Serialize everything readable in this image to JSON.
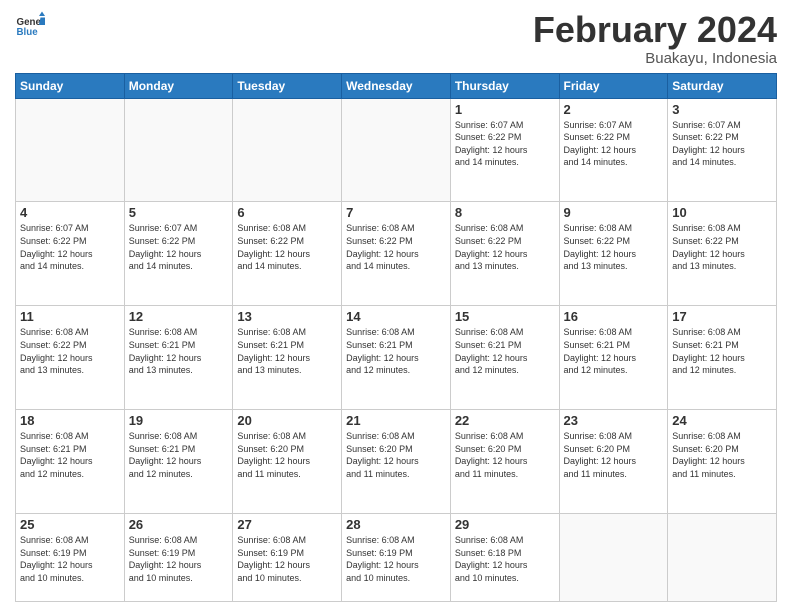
{
  "header": {
    "logo_general": "General",
    "logo_blue": "Blue",
    "month_title": "February 2024",
    "subtitle": "Buakayu, Indonesia"
  },
  "weekdays": [
    "Sunday",
    "Monday",
    "Tuesday",
    "Wednesday",
    "Thursday",
    "Friday",
    "Saturday"
  ],
  "weeks": [
    [
      {
        "day": "",
        "info": ""
      },
      {
        "day": "",
        "info": ""
      },
      {
        "day": "",
        "info": ""
      },
      {
        "day": "",
        "info": ""
      },
      {
        "day": "1",
        "info": "Sunrise: 6:07 AM\nSunset: 6:22 PM\nDaylight: 12 hours\nand 14 minutes."
      },
      {
        "day": "2",
        "info": "Sunrise: 6:07 AM\nSunset: 6:22 PM\nDaylight: 12 hours\nand 14 minutes."
      },
      {
        "day": "3",
        "info": "Sunrise: 6:07 AM\nSunset: 6:22 PM\nDaylight: 12 hours\nand 14 minutes."
      }
    ],
    [
      {
        "day": "4",
        "info": "Sunrise: 6:07 AM\nSunset: 6:22 PM\nDaylight: 12 hours\nand 14 minutes."
      },
      {
        "day": "5",
        "info": "Sunrise: 6:07 AM\nSunset: 6:22 PM\nDaylight: 12 hours\nand 14 minutes."
      },
      {
        "day": "6",
        "info": "Sunrise: 6:08 AM\nSunset: 6:22 PM\nDaylight: 12 hours\nand 14 minutes."
      },
      {
        "day": "7",
        "info": "Sunrise: 6:08 AM\nSunset: 6:22 PM\nDaylight: 12 hours\nand 14 minutes."
      },
      {
        "day": "8",
        "info": "Sunrise: 6:08 AM\nSunset: 6:22 PM\nDaylight: 12 hours\nand 13 minutes."
      },
      {
        "day": "9",
        "info": "Sunrise: 6:08 AM\nSunset: 6:22 PM\nDaylight: 12 hours\nand 13 minutes."
      },
      {
        "day": "10",
        "info": "Sunrise: 6:08 AM\nSunset: 6:22 PM\nDaylight: 12 hours\nand 13 minutes."
      }
    ],
    [
      {
        "day": "11",
        "info": "Sunrise: 6:08 AM\nSunset: 6:22 PM\nDaylight: 12 hours\nand 13 minutes."
      },
      {
        "day": "12",
        "info": "Sunrise: 6:08 AM\nSunset: 6:21 PM\nDaylight: 12 hours\nand 13 minutes."
      },
      {
        "day": "13",
        "info": "Sunrise: 6:08 AM\nSunset: 6:21 PM\nDaylight: 12 hours\nand 13 minutes."
      },
      {
        "day": "14",
        "info": "Sunrise: 6:08 AM\nSunset: 6:21 PM\nDaylight: 12 hours\nand 12 minutes."
      },
      {
        "day": "15",
        "info": "Sunrise: 6:08 AM\nSunset: 6:21 PM\nDaylight: 12 hours\nand 12 minutes."
      },
      {
        "day": "16",
        "info": "Sunrise: 6:08 AM\nSunset: 6:21 PM\nDaylight: 12 hours\nand 12 minutes."
      },
      {
        "day": "17",
        "info": "Sunrise: 6:08 AM\nSunset: 6:21 PM\nDaylight: 12 hours\nand 12 minutes."
      }
    ],
    [
      {
        "day": "18",
        "info": "Sunrise: 6:08 AM\nSunset: 6:21 PM\nDaylight: 12 hours\nand 12 minutes."
      },
      {
        "day": "19",
        "info": "Sunrise: 6:08 AM\nSunset: 6:21 PM\nDaylight: 12 hours\nand 12 minutes."
      },
      {
        "day": "20",
        "info": "Sunrise: 6:08 AM\nSunset: 6:20 PM\nDaylight: 12 hours\nand 11 minutes."
      },
      {
        "day": "21",
        "info": "Sunrise: 6:08 AM\nSunset: 6:20 PM\nDaylight: 12 hours\nand 11 minutes."
      },
      {
        "day": "22",
        "info": "Sunrise: 6:08 AM\nSunset: 6:20 PM\nDaylight: 12 hours\nand 11 minutes."
      },
      {
        "day": "23",
        "info": "Sunrise: 6:08 AM\nSunset: 6:20 PM\nDaylight: 12 hours\nand 11 minutes."
      },
      {
        "day": "24",
        "info": "Sunrise: 6:08 AM\nSunset: 6:20 PM\nDaylight: 12 hours\nand 11 minutes."
      }
    ],
    [
      {
        "day": "25",
        "info": "Sunrise: 6:08 AM\nSunset: 6:19 PM\nDaylight: 12 hours\nand 10 minutes."
      },
      {
        "day": "26",
        "info": "Sunrise: 6:08 AM\nSunset: 6:19 PM\nDaylight: 12 hours\nand 10 minutes."
      },
      {
        "day": "27",
        "info": "Sunrise: 6:08 AM\nSunset: 6:19 PM\nDaylight: 12 hours\nand 10 minutes."
      },
      {
        "day": "28",
        "info": "Sunrise: 6:08 AM\nSunset: 6:19 PM\nDaylight: 12 hours\nand 10 minutes."
      },
      {
        "day": "29",
        "info": "Sunrise: 6:08 AM\nSunset: 6:18 PM\nDaylight: 12 hours\nand 10 minutes."
      },
      {
        "day": "",
        "info": ""
      },
      {
        "day": "",
        "info": ""
      }
    ]
  ]
}
